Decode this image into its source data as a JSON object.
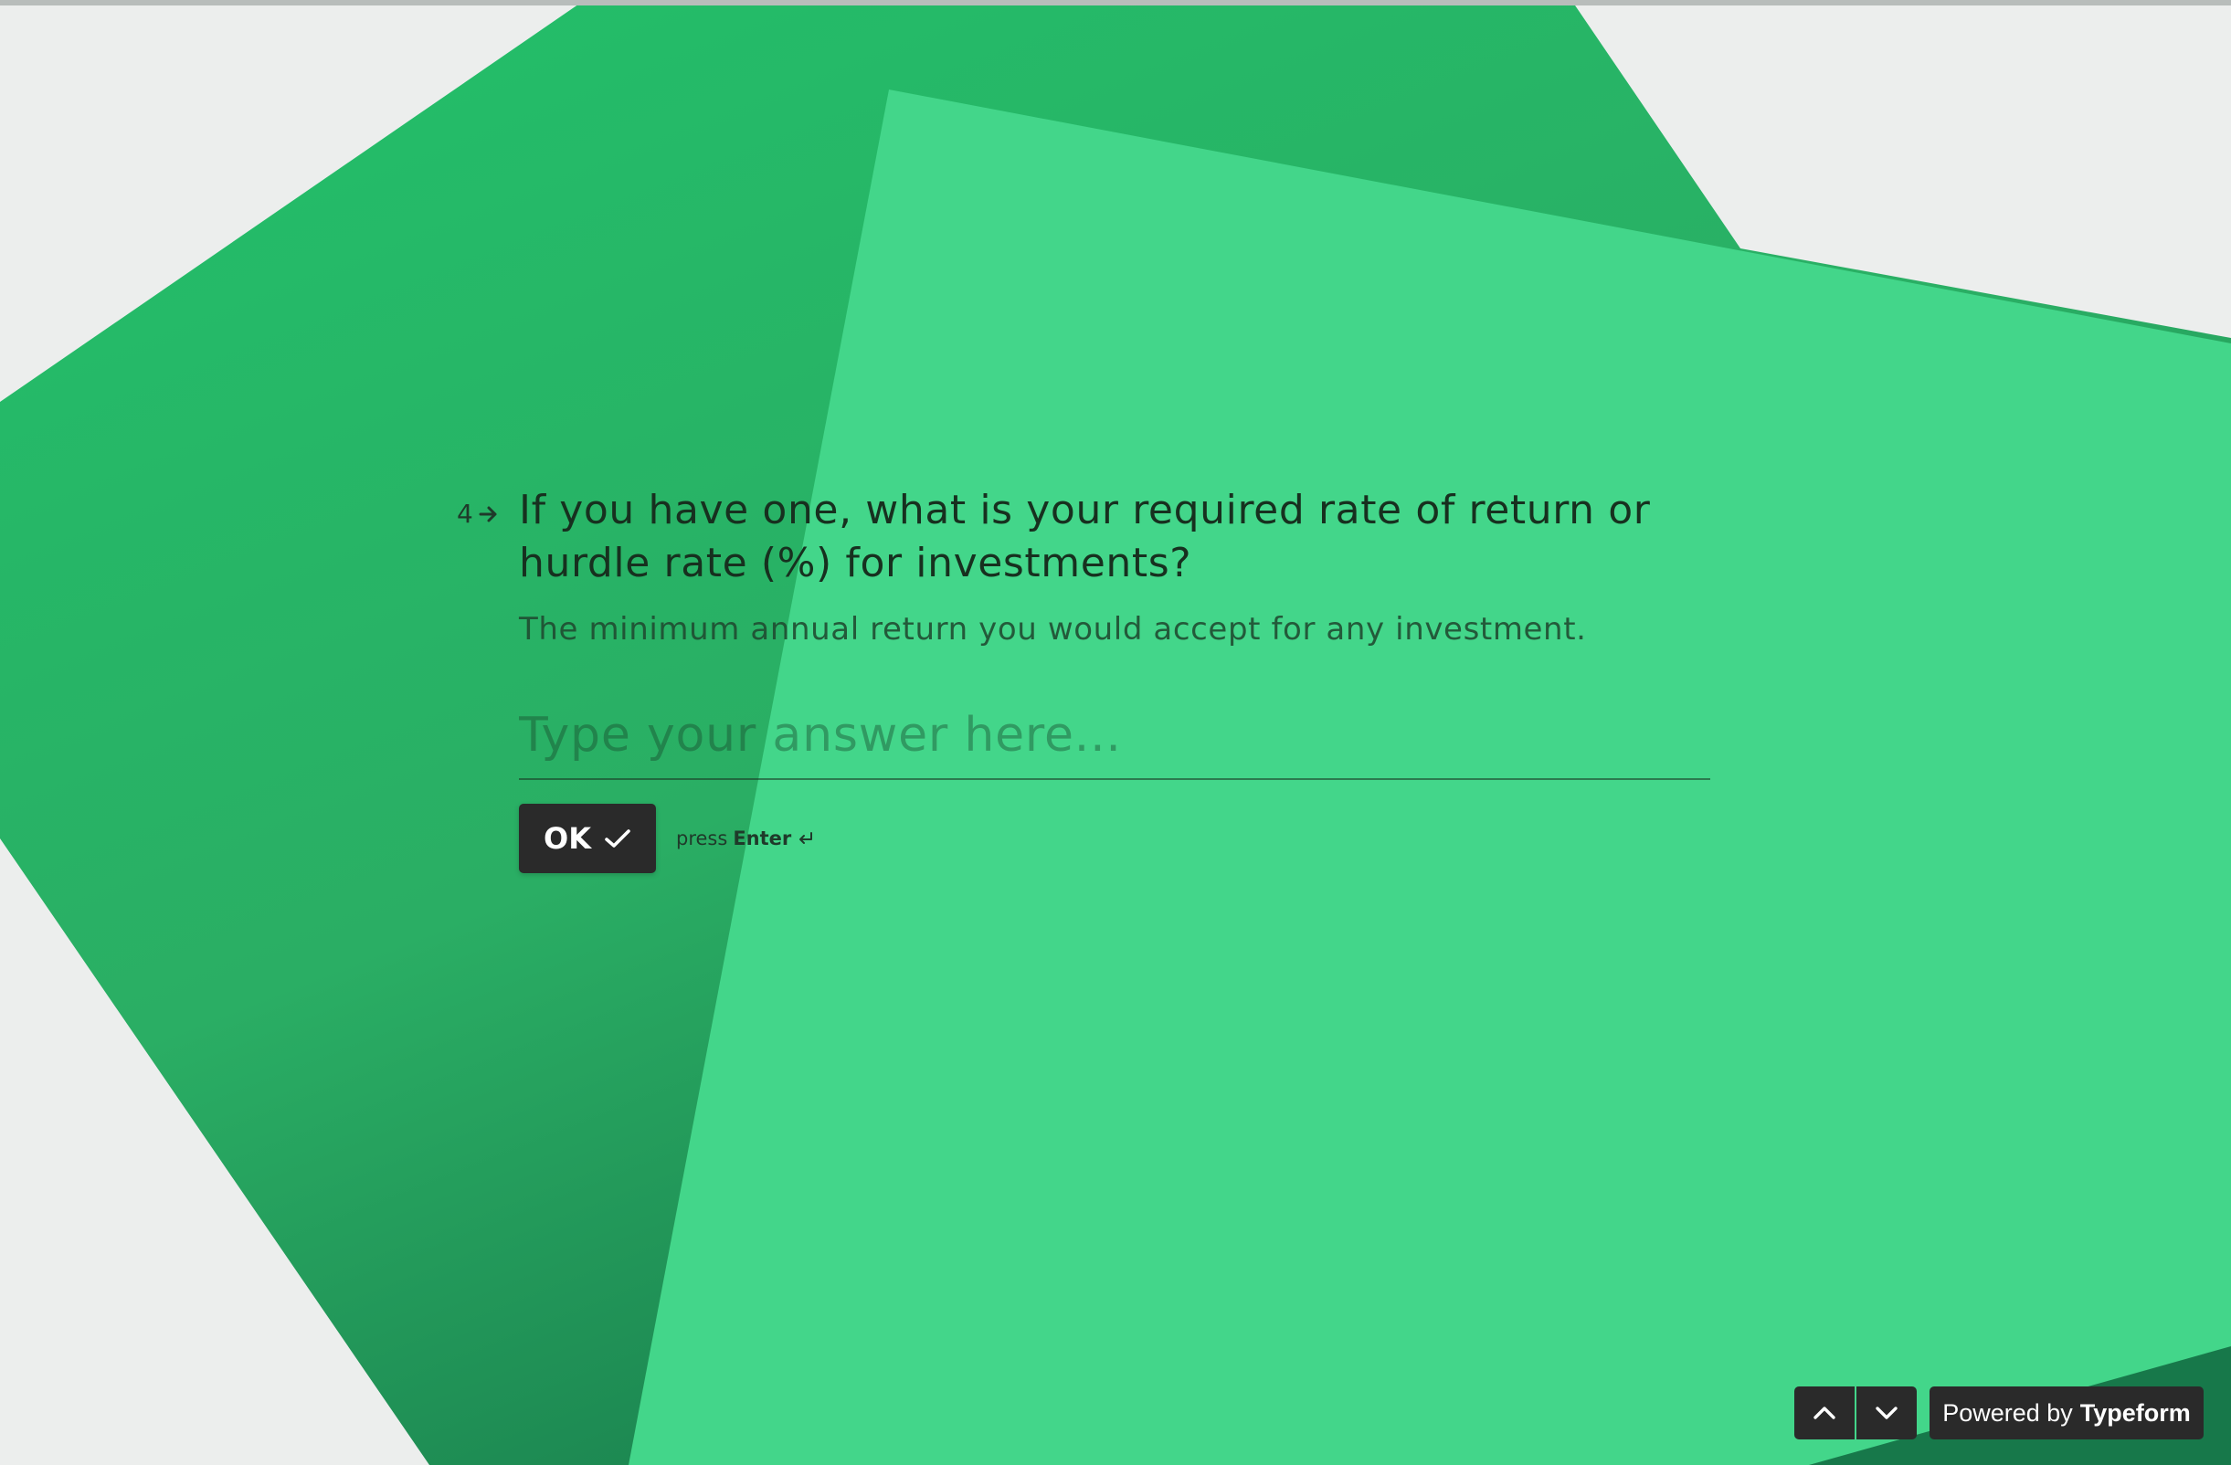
{
  "question": {
    "number": "4",
    "title": "If you have one, what is your required rate of return or hurdle rate (%) for investments?",
    "description": "The minimum annual return you would accept for any investment."
  },
  "answer": {
    "placeholder": "Type your answer here...",
    "value": ""
  },
  "ok_button": {
    "label": "OK",
    "icon": "checkmark-icon"
  },
  "press_hint": {
    "prefix": "press",
    "key": "Enter",
    "icon": "return-key-icon"
  },
  "navigation": {
    "up_icon": "chevron-up-icon",
    "down_icon": "chevron-down-icon"
  },
  "branding": {
    "prefix": "Powered by",
    "brand": "Typeform"
  },
  "colors": {
    "background": "#eceeed",
    "shape_dark_green": "#25b866",
    "shape_light_green": "#43d68a",
    "button_dark": "#2a2a2a",
    "text_dark": "#17301f"
  }
}
